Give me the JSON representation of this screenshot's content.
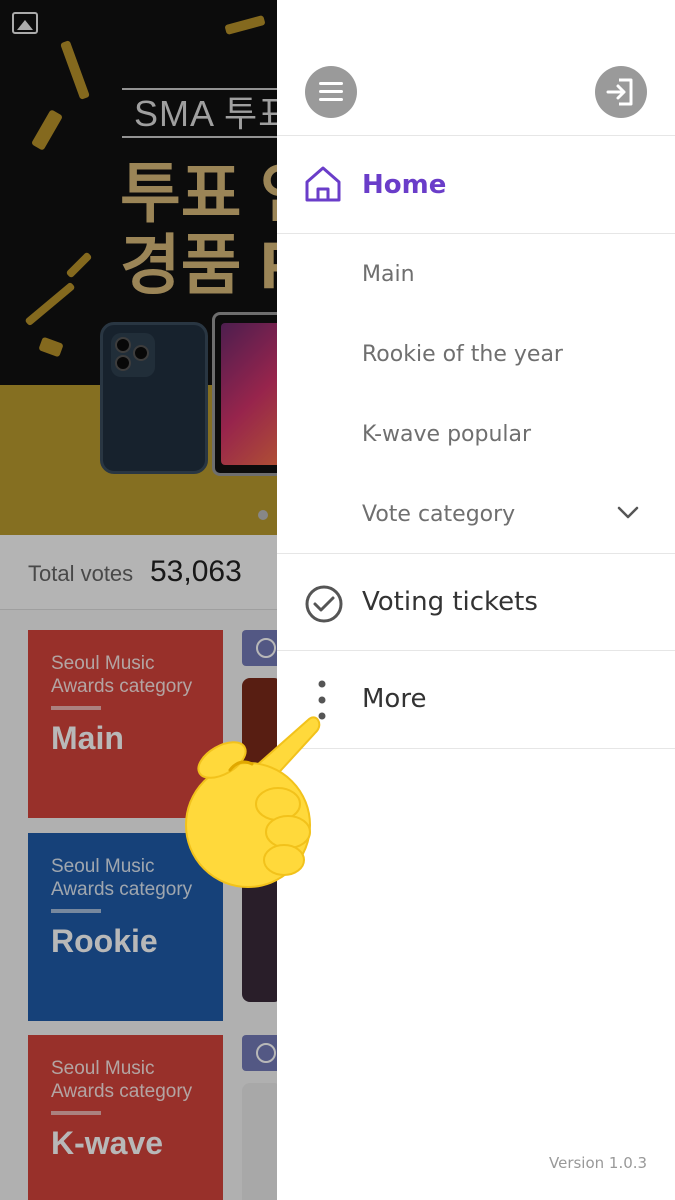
{
  "banner": {
    "title": "SMA 투표",
    "line1": "투표 인",
    "line2": "경품 F"
  },
  "summary": {
    "total_votes_label": "Total votes",
    "total_votes_value": "53,063"
  },
  "categories": [
    {
      "subtitle": "Seoul Music Awards category",
      "name": "Main"
    },
    {
      "subtitle": "Seoul Music Awards category",
      "name": "Rookie"
    },
    {
      "subtitle": "Seoul Music Awards category",
      "name": "K-wave"
    }
  ],
  "drawer": {
    "home_label": "Home",
    "sub_items": [
      "Main",
      "Rookie of the year",
      "K-wave popular"
    ],
    "vote_category_label": "Vote category",
    "voting_tickets_label": "Voting tickets",
    "more_label": "More",
    "version": "Version 1.0.3"
  },
  "colors": {
    "accent": "#6a3dc9",
    "main_card": "#d3433b",
    "rookie_card": "#1f5aa8",
    "kwave_card": "#d3433b"
  },
  "icons": {
    "menu": "hamburger-icon",
    "login": "login-icon",
    "home": "home-icon",
    "voting": "check-circle-icon",
    "more": "vertical-dots-icon",
    "expand": "chevron-down-icon",
    "gallery": "image-icon",
    "pointer": "pointing-hand-emoji"
  }
}
